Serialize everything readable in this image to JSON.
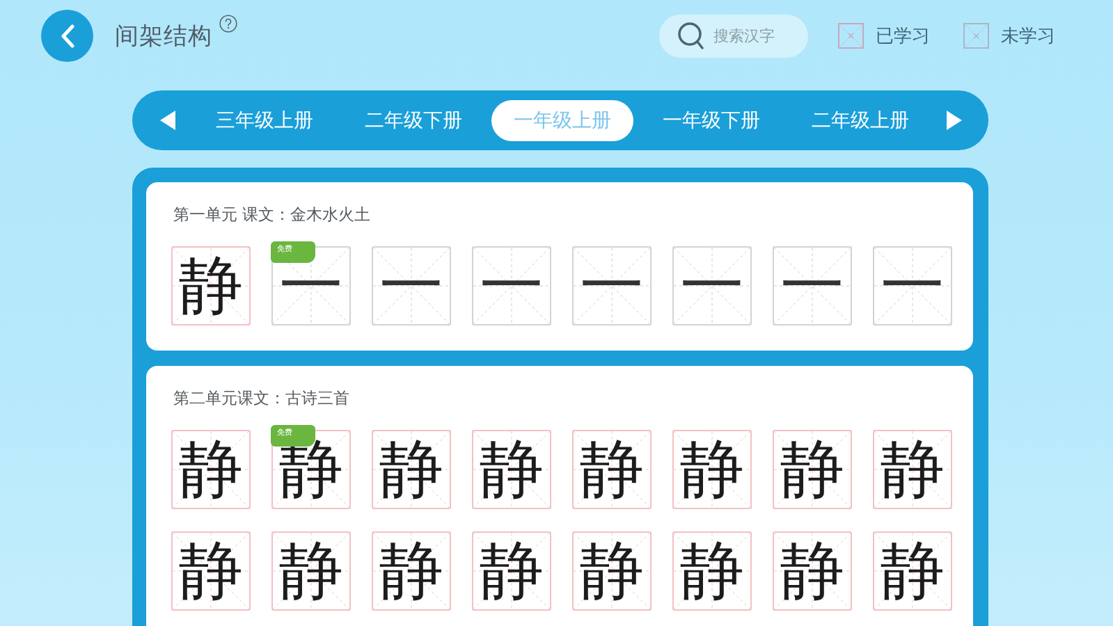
{
  "header": {
    "title": "间架结构",
    "search": {
      "placeholder": "搜索汉字"
    },
    "legend": [
      {
        "label": "已学习",
        "kind": "learned"
      },
      {
        "label": "未学习",
        "kind": "unlearned"
      }
    ]
  },
  "grade_tabs": [
    {
      "label": "三年级上册",
      "selected": false
    },
    {
      "label": "二年级下册",
      "selected": false
    },
    {
      "label": "一年级上册",
      "selected": true
    },
    {
      "label": "一年级下册",
      "selected": false
    },
    {
      "label": "二年级上册",
      "selected": false
    }
  ],
  "units": [
    {
      "title": "第一单元 课文：金木水火土",
      "characters": [
        {
          "char": "静",
          "learned": true
        },
        {
          "char": "一",
          "learned": false,
          "badge": "免费"
        },
        {
          "char": "一",
          "learned": false
        },
        {
          "char": "一",
          "learned": false
        },
        {
          "char": "一",
          "learned": false
        },
        {
          "char": "一",
          "learned": false
        },
        {
          "char": "一",
          "learned": false
        },
        {
          "char": "一",
          "learned": false
        }
      ]
    },
    {
      "title": "第二单元课文：古诗三首",
      "characters": [
        {
          "char": "静",
          "learned": true
        },
        {
          "char": "静",
          "learned": true,
          "badge": "免费"
        },
        {
          "char": "静",
          "learned": true
        },
        {
          "char": "静",
          "learned": true
        },
        {
          "char": "静",
          "learned": true
        },
        {
          "char": "静",
          "learned": true
        },
        {
          "char": "静",
          "learned": true
        },
        {
          "char": "静",
          "learned": true
        },
        {
          "char": "静",
          "learned": true
        },
        {
          "char": "静",
          "learned": true
        },
        {
          "char": "静",
          "learned": true
        },
        {
          "char": "静",
          "learned": true
        },
        {
          "char": "静",
          "learned": true
        },
        {
          "char": "静",
          "learned": true
        },
        {
          "char": "静",
          "learned": true
        },
        {
          "char": "静",
          "learned": true
        }
      ]
    }
  ]
}
